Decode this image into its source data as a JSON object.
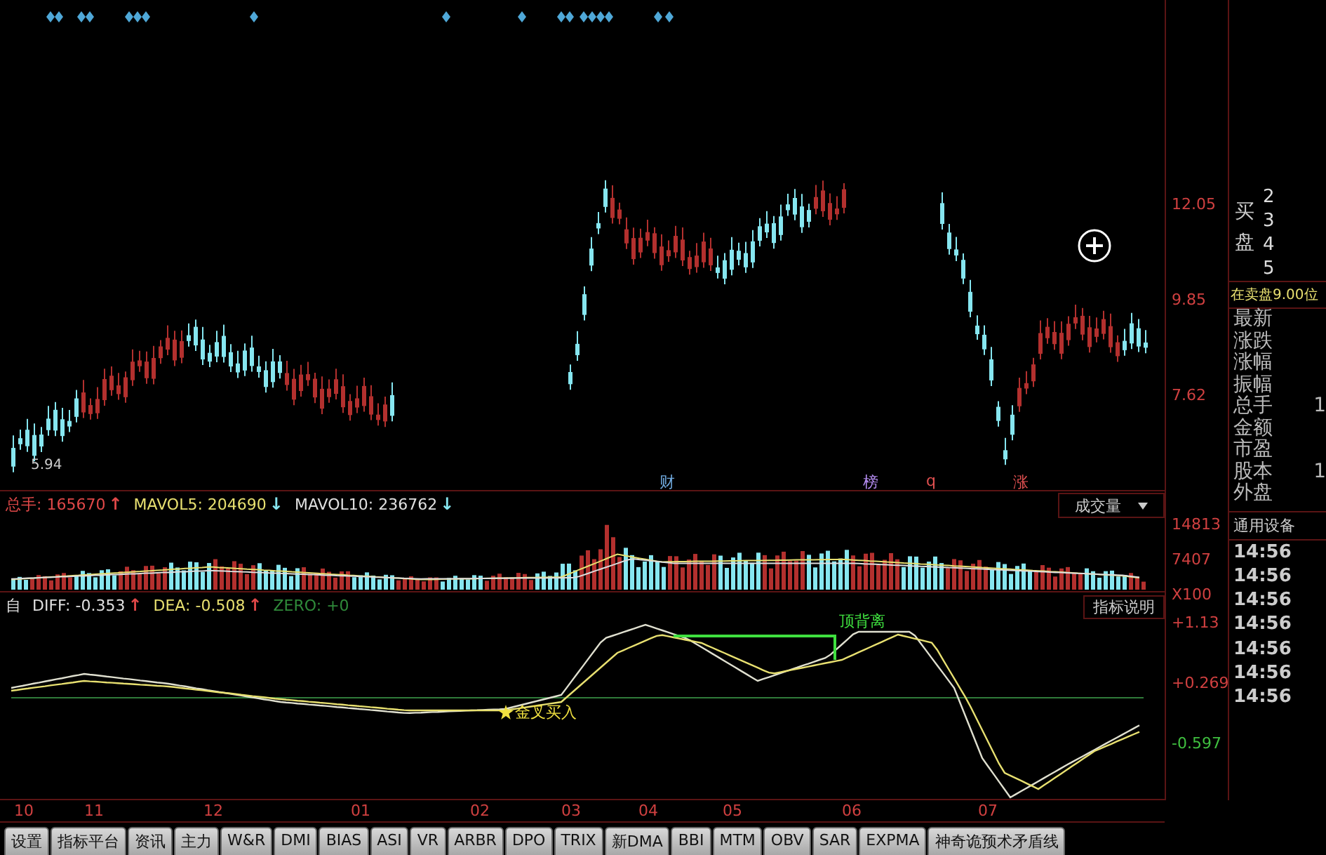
{
  "price_panel": {
    "low_label": "5.94",
    "markers": [
      {
        "text": "财",
        "color": "#6fa8dc"
      },
      {
        "text": "榜",
        "color": "#b48cf0"
      },
      {
        "text": "q",
        "color": "#e05050"
      },
      {
        "text": "涨",
        "color": "#e05050"
      }
    ],
    "axis": [
      {
        "text": "12.05",
        "color": "#d04040"
      },
      {
        "text": "9.85",
        "color": "#d04040"
      },
      {
        "text": "7.62",
        "color": "#d04040"
      }
    ]
  },
  "volume_panel": {
    "readings": [
      {
        "label": "总手:",
        "value": "165670",
        "arrow": "↑",
        "rising": true,
        "color": "#e04848"
      },
      {
        "label": "MAVOL5:",
        "value": "204690",
        "arrow": "↓",
        "rising": false,
        "color": "#e8e070"
      },
      {
        "label": "MAVOL10:",
        "value": "236762",
        "arrow": "↓",
        "rising": false,
        "color": "#e0e0e0"
      }
    ],
    "dropdown": "成交量",
    "axis": [
      {
        "text": "14813",
        "color": "#d04040"
      },
      {
        "text": "7407",
        "color": "#d04040"
      },
      {
        "text": "X100",
        "color": "#d04040"
      }
    ]
  },
  "macd_panel": {
    "prefix": "自",
    "readings": [
      {
        "label": "DIFF:",
        "value": "-0.353",
        "arrow": "↑",
        "rising": true,
        "color": "#e0e0e0"
      },
      {
        "label": "DEA:",
        "value": "-0.508",
        "arrow": "↑",
        "rising": true,
        "color": "#e8e070"
      },
      {
        "label": "ZERO:",
        "value": "+0",
        "color": "#2f8a3a"
      }
    ],
    "help_button": "指标说明",
    "annotations": [
      {
        "kind": "divergence",
        "text": "顶背离"
      },
      {
        "kind": "buy",
        "text": "金叉买入"
      }
    ],
    "axis": [
      {
        "text": "+1.13",
        "color": "#d04040"
      },
      {
        "text": "+0.269",
        "color": "#d04040"
      },
      {
        "text": "-0.597",
        "color": "#3fbf3f"
      }
    ]
  },
  "dates": [
    "10",
    "11",
    "12",
    "01",
    "02",
    "03",
    "04",
    "05",
    "06",
    "07"
  ],
  "tabs": [
    {
      "label": "设置",
      "selected": false
    },
    {
      "label": "指标平台",
      "selected": false
    },
    {
      "label": "资讯",
      "selected": false
    },
    {
      "label": "主力",
      "selected": false
    },
    {
      "label": "W&R",
      "selected": false
    },
    {
      "label": "DMI",
      "selected": false
    },
    {
      "label": "BIAS",
      "selected": false
    },
    {
      "label": "ASI",
      "selected": false
    },
    {
      "label": "VR",
      "selected": false
    },
    {
      "label": "ARBR",
      "selected": false
    },
    {
      "label": "DPO",
      "selected": false
    },
    {
      "label": "TRIX",
      "selected": false
    },
    {
      "label": "新DMA",
      "selected": false
    },
    {
      "label": "BBI",
      "selected": false
    },
    {
      "label": "MTM",
      "selected": false
    },
    {
      "label": "OBV",
      "selected": false
    },
    {
      "label": "SAR",
      "selected": false
    },
    {
      "label": "EXPMA",
      "selected": false
    },
    {
      "label": "神奇诡预术矛盾线",
      "selected": false
    }
  ],
  "quote_panel": {
    "order_book": {
      "side_label": "买盘",
      "levels": [
        "2",
        "3",
        "4",
        "5"
      ]
    },
    "status": "在卖盘9.00位",
    "rows": [
      {
        "label": "最新"
      },
      {
        "label": "涨跌"
      },
      {
        "label": "涨幅"
      },
      {
        "label": "振幅"
      },
      {
        "label": "总手",
        "value": "1"
      },
      {
        "label": "金额"
      },
      {
        "label": "市盈"
      },
      {
        "label": "股本",
        "value": "1"
      },
      {
        "label": "外盘"
      }
    ],
    "industry": "通用设备",
    "times": [
      "14:56",
      "14:56",
      "14:56",
      "14:56",
      "14:56",
      "14:56",
      "14:56"
    ]
  }
}
